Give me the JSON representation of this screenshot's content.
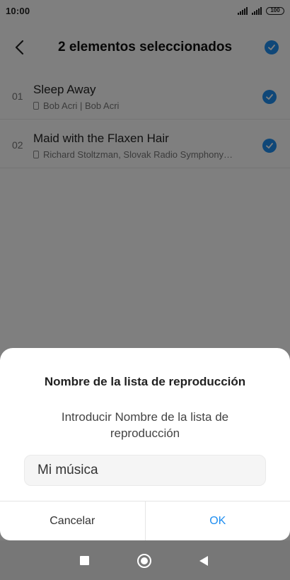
{
  "status_bar": {
    "time": "10:00",
    "battery": "100"
  },
  "header": {
    "title": "2 elementos seleccionados",
    "back_icon": "chevron-left-icon",
    "select_all_icon": "check-circle-icon"
  },
  "tracks": [
    {
      "number": "01",
      "title": "Sleep Away",
      "subtitle": "Bob Acri | Bob Acri",
      "selected": true
    },
    {
      "number": "02",
      "title": "Maid with the Flaxen Hair",
      "subtitle": "Richard Stoltzman, Slovak Radio Symphony…",
      "selected": true
    }
  ],
  "dialog": {
    "title": "Nombre de la lista de reproducción",
    "message": "Introducir Nombre de la lista de reproducción",
    "input_value": "Mi música",
    "cancel_label": "Cancelar",
    "ok_label": "OK"
  },
  "colors": {
    "accent": "#1f8ef1",
    "overlay": "rgba(0,0,0,0.5)"
  }
}
